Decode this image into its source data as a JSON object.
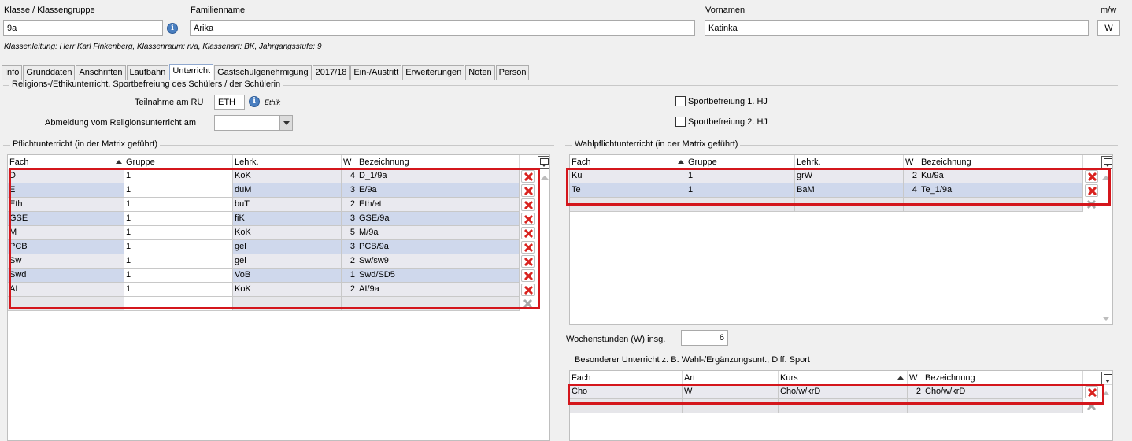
{
  "header": {
    "klasse_label": "Klasse / Klassengruppe",
    "klasse_value": "9a",
    "familienname_label": "Familienname",
    "familienname_value": "Arika",
    "vornamen_label": "Vornamen",
    "vornamen_value": "Katinka",
    "mw_label": "m/w",
    "mw_value": "W",
    "klassenleitung": "Klassenleitung: Herr Karl Finkenberg, Klassenraum: n/a, Klassenart: BK, Jahrgangsstufe: 9",
    "info_icon_label": "i"
  },
  "tabs": [
    {
      "label": "Info"
    },
    {
      "label": "Grunddaten"
    },
    {
      "label": "Anschriften"
    },
    {
      "label": "Laufbahn"
    },
    {
      "label": "Unterricht",
      "active": true
    },
    {
      "label": "Gastschulgenehmigung"
    },
    {
      "label": "2017/18"
    },
    {
      "label": "Ein-/Austritt"
    },
    {
      "label": "Erweiterungen"
    },
    {
      "label": "Noten"
    },
    {
      "label": "Person"
    }
  ],
  "religion": {
    "group_title": "Religions-/Ethikunterricht, Sportbefreiung des Schülers / der Schülerin",
    "teilnahme_label": "Teilnahme am RU",
    "teilnahme_value": "ETH",
    "teilnahme_hint": "Ethik",
    "abmeldung_label": "Abmeldung vom Religionsunterricht am",
    "abmeldung_value": "",
    "sport1_label": "Sportbefreiung 1. HJ",
    "sport2_label": "Sportbefreiung 2. HJ"
  },
  "pflicht": {
    "group_title": "Pflichtunterricht (in der Matrix geführt)",
    "columns": [
      "Fach",
      "Gruppe",
      "Lehrk.",
      "W",
      "Bezeichnung"
    ],
    "rows": [
      {
        "fach": "D",
        "gruppe": "1",
        "lehrk": "KoK",
        "w": "4",
        "bez": "D_1/9a"
      },
      {
        "fach": "E",
        "gruppe": "1",
        "lehrk": "duM",
        "w": "3",
        "bez": "E/9a"
      },
      {
        "fach": "Eth",
        "gruppe": "1",
        "lehrk": "buT",
        "w": "2",
        "bez": "Eth/et"
      },
      {
        "fach": "GSE",
        "gruppe": "1",
        "lehrk": "fiK",
        "w": "3",
        "bez": "GSE/9a"
      },
      {
        "fach": "M",
        "gruppe": "1",
        "lehrk": "KoK",
        "w": "5",
        "bez": "M/9a"
      },
      {
        "fach": "PCB",
        "gruppe": "1",
        "lehrk": "gel",
        "w": "3",
        "bez": "PCB/9a"
      },
      {
        "fach": "Sw",
        "gruppe": "1",
        "lehrk": "gel",
        "w": "2",
        "bez": "Sw/sw9"
      },
      {
        "fach": "Swd",
        "gruppe": "1",
        "lehrk": "VoB",
        "w": "1",
        "bez": "Swd/SD5"
      },
      {
        "fach": "AI",
        "gruppe": "1",
        "lehrk": "KoK",
        "w": "2",
        "bez": "AI/9a"
      }
    ]
  },
  "wahlpflicht": {
    "group_title": "Wahlpflichtunterricht (in der Matrix geführt)",
    "columns": [
      "Fach",
      "Gruppe",
      "Lehrk.",
      "W",
      "Bezeichnung"
    ],
    "rows": [
      {
        "fach": "Ku",
        "gruppe": "1",
        "lehrk": "grW",
        "w": "2",
        "bez": "Ku/9a"
      },
      {
        "fach": "Te",
        "gruppe": "1",
        "lehrk": "BaM",
        "w": "4",
        "bez": "Te_1/9a"
      }
    ]
  },
  "wochenstunden": {
    "label": "Wochenstunden (W) insg.",
    "value": "6"
  },
  "besonderer": {
    "group_title": "Besonderer Unterricht z. B. Wahl-/Ergänzungsunt., Diff. Sport",
    "columns": [
      "Fach",
      "Art",
      "Kurs",
      "W",
      "Bezeichnung"
    ],
    "rows": [
      {
        "fach": "Cho",
        "art": "W",
        "kurs": "Cho/w/krD",
        "w": "2",
        "bez": "Cho/w/krD"
      }
    ]
  },
  "colors": {
    "highlight_border": "#d4161c",
    "row_even": "#cfd8ec",
    "row_odd": "#e9e9ef",
    "delete_icon": "#d9231f"
  }
}
